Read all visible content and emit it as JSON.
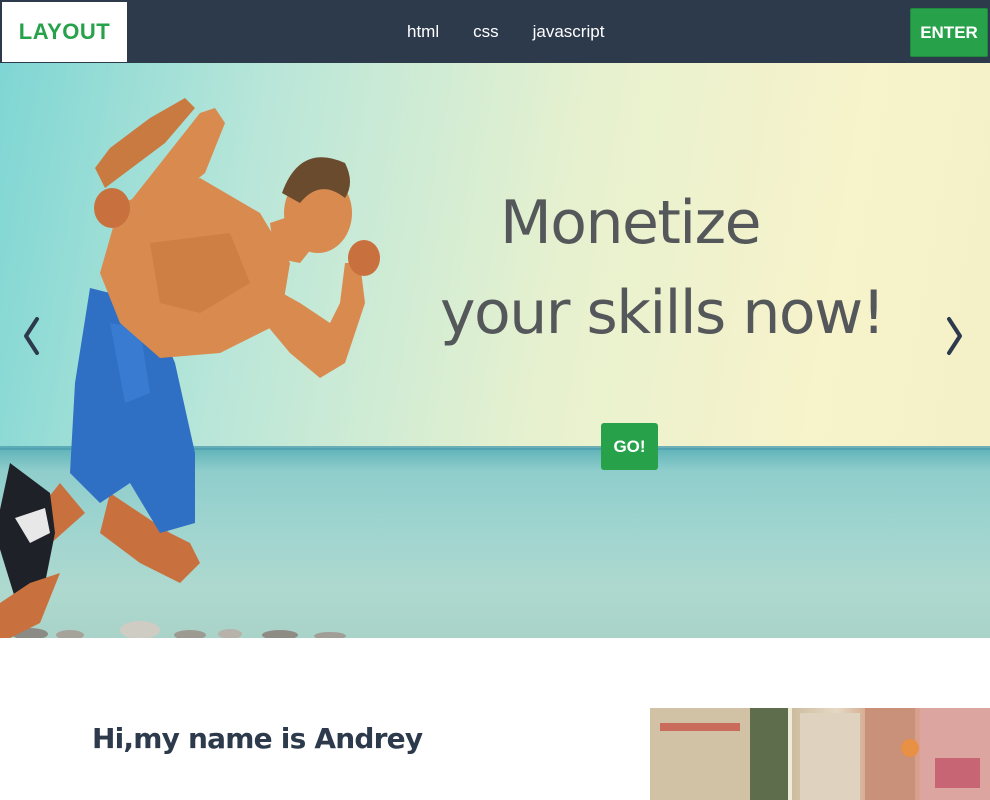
{
  "navbar": {
    "logo": "LAYOUT",
    "links": [
      "html",
      "css",
      "javascript"
    ],
    "enter_label": "ENTER"
  },
  "hero": {
    "headline_line1": "Monetize",
    "headline_line2": "your skills now!",
    "cta_label": "GO!",
    "prev_icon": "chevron-left-icon",
    "next_icon": "chevron-right-icon"
  },
  "about": {
    "title": "Hi,my name is Andrey"
  },
  "colors": {
    "nav_bg": "#2c3a4c",
    "accent_green": "#27a24a",
    "headline_gray": "#55585a",
    "arrow_dark": "#2c3a4c"
  }
}
